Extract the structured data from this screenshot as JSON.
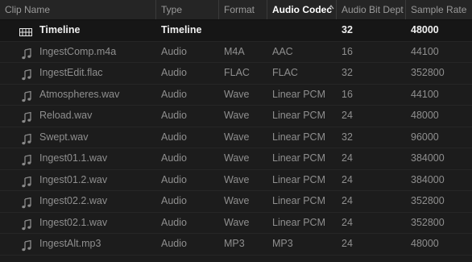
{
  "header": {
    "columns": [
      "Clip Name",
      "Type",
      "Format",
      "Audio Codec",
      "Audio Bit Dept",
      "Sample Rate"
    ],
    "sorted_column_icon": "sort-arrow-icon"
  },
  "rows": [
    {
      "icon": "timeline-icon",
      "name": "Timeline",
      "type": "Timeline",
      "format": "",
      "codec": "",
      "bit_depth": "32",
      "sample_rate": "48000"
    },
    {
      "icon": "audio-clip-icon",
      "name": "IngestComp.m4a",
      "type": "Audio",
      "format": "M4A",
      "codec": "AAC",
      "bit_depth": "16",
      "sample_rate": "44100"
    },
    {
      "icon": "audio-clip-icon",
      "name": "IngestEdit.flac",
      "type": "Audio",
      "format": "FLAC",
      "codec": "FLAC",
      "bit_depth": "32",
      "sample_rate": "352800"
    },
    {
      "icon": "audio-clip-icon",
      "name": "Atmospheres.wav",
      "type": "Audio",
      "format": "Wave",
      "codec": "Linear PCM",
      "bit_depth": "16",
      "sample_rate": "44100"
    },
    {
      "icon": "audio-clip-icon",
      "name": "Reload.wav",
      "type": "Audio",
      "format": "Wave",
      "codec": "Linear PCM",
      "bit_depth": "24",
      "sample_rate": "48000"
    },
    {
      "icon": "audio-clip-icon",
      "name": "Swept.wav",
      "type": "Audio",
      "format": "Wave",
      "codec": "Linear PCM",
      "bit_depth": "32",
      "sample_rate": "96000"
    },
    {
      "icon": "audio-clip-icon",
      "name": "Ingest01.1.wav",
      "type": "Audio",
      "format": "Wave",
      "codec": "Linear PCM",
      "bit_depth": "24",
      "sample_rate": "384000"
    },
    {
      "icon": "audio-clip-icon",
      "name": "Ingest01.2.wav",
      "type": "Audio",
      "format": "Wave",
      "codec": "Linear PCM",
      "bit_depth": "24",
      "sample_rate": "384000"
    },
    {
      "icon": "audio-clip-icon",
      "name": "Ingest02.2.wav",
      "type": "Audio",
      "format": "Wave",
      "codec": "Linear PCM",
      "bit_depth": "24",
      "sample_rate": "352800"
    },
    {
      "icon": "audio-clip-icon",
      "name": "Ingest02.1.wav",
      "type": "Audio",
      "format": "Wave",
      "codec": "Linear PCM",
      "bit_depth": "24",
      "sample_rate": "352800"
    },
    {
      "icon": "audio-clip-icon",
      "name": "IngestAlt.mp3",
      "type": "Audio",
      "format": "MP3",
      "codec": "MP3",
      "bit_depth": "24",
      "sample_rate": "48000"
    }
  ]
}
